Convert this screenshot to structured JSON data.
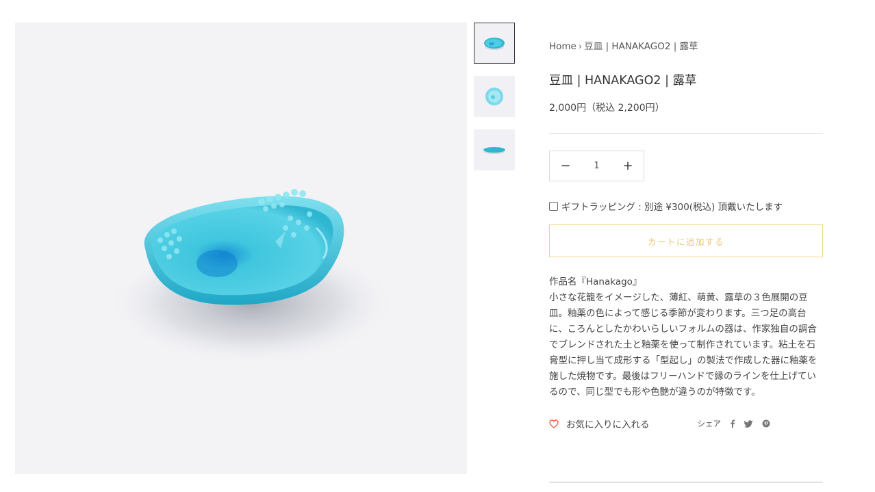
{
  "breadcrumb": {
    "home": "Home",
    "separator": "›",
    "current": "豆皿 | HANAKAGO2 | 露草"
  },
  "product": {
    "title": "豆皿 | HANAKAGO2 | 露草",
    "price": "2,000円（税込 2,200円）",
    "quantity": "1",
    "minus_label": "−",
    "plus_label": "+",
    "gift_label": "ギフトラッピング : 別途 ¥300(税込) 頂戴いたします",
    "add_to_cart": "カートに追加する",
    "description_name": "作品名『Hanakago』",
    "description_body": "小さな花籠をイメージした、薄紅、萌黄、露草の３色展開の豆皿。釉薬の色によって感じる季節が変わります。三つ足の高台に、ころんとしたかわいらしいフォルムの器は、作家独自の調合でブレンドされた土と釉薬を使って制作されています。粘土を石膏型に押し当て成形する「型起し」の製法で作成した器に釉薬を施した焼物です。最後はフリーハンドで縁のラインを仕上げているので、同じ型でも形や色艶が違うのが特徴です。"
  },
  "actions": {
    "favorite": "お気に入りに入れる",
    "share": "シェア",
    "share_icons": [
      "facebook-icon",
      "twitter-icon",
      "pinterest-icon"
    ]
  },
  "colors": {
    "accent_gold": "#e9c978",
    "favorite_heart": "#e8643c",
    "dish_turquoise": "#3fc6de"
  }
}
